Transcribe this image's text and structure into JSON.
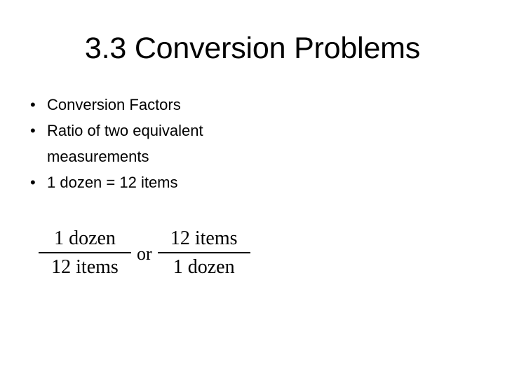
{
  "slide": {
    "title": "3.3 Conversion Problems",
    "bullets": [
      {
        "marker": "•",
        "text": "Conversion Factors"
      },
      {
        "marker": "•",
        "text": "Ratio of two equivalent measurements"
      },
      {
        "marker": "•",
        "text": "1 dozen = 12 items"
      }
    ],
    "equation": {
      "left_fraction": {
        "numerator": "1 dozen",
        "denominator": "12 items"
      },
      "separator": "or",
      "right_fraction": {
        "numerator": "12 items",
        "denominator": "1 dozen"
      }
    }
  },
  "colors": {
    "background": "#ffffff",
    "text": "#000000"
  }
}
